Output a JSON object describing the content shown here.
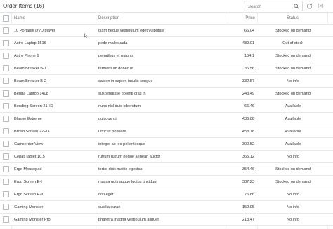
{
  "toolbar": {
    "title": "Order Items (16)",
    "search_placeholder": "Search",
    "search_icon": "magnifier-icon",
    "refresh_icon": "refresh-icon",
    "fullscreen_label": "[x]"
  },
  "table": {
    "columns": [
      "Name",
      "Description",
      "Price",
      "Status"
    ],
    "rows": [
      {
        "name": "10 Portable DVD player",
        "description": "diam neque vestibulum eget vulputate",
        "price": "66.04",
        "status": "Stocked on demand"
      },
      {
        "name": "Astro Laptop 1516",
        "description": "pede malesuada",
        "price": "489.01",
        "status": "Out of stock"
      },
      {
        "name": "Astro Phone 6",
        "description": "penatibus et magnis",
        "price": "154.1",
        "status": "Stocked on demand"
      },
      {
        "name": "Beam Breaker B-1",
        "description": "fermentum donec ut",
        "price": "36.56",
        "status": "Stocked on demand"
      },
      {
        "name": "Beam Breaker B-2",
        "description": "sapien in sapien iaculis congue",
        "price": "332.57",
        "status": "No info"
      },
      {
        "name": "Benda Laptop 1408",
        "description": "suspendisse potenti cras in",
        "price": "243.49",
        "status": "Stocked on demand"
      },
      {
        "name": "Bending Screen 21HD",
        "description": "nunc nisl duis bibendum",
        "price": "66.46",
        "status": "Available"
      },
      {
        "name": "Blaster Extreme",
        "description": "quisque ut",
        "price": "436.88",
        "status": "Available"
      },
      {
        "name": "Broad Screen 22HD",
        "description": "ultrices posuere",
        "price": "458.18",
        "status": "Available"
      },
      {
        "name": "Camcorder View",
        "description": "integer ac leo pellentesque",
        "price": "300.52",
        "status": "Available"
      },
      {
        "name": "Cepat Tablet 10.5",
        "description": "rutrum rutrum neque aenean auctor",
        "price": "365.12",
        "status": "No info"
      },
      {
        "name": "Ergo Mousepad",
        "description": "tortor duis mattis egestas",
        "price": "354.46",
        "status": "Stocked on demand"
      },
      {
        "name": "Ergo Screen E-I",
        "description": "massa quis augue luctus tincidunt",
        "price": "387.23",
        "status": "Stocked on demand"
      },
      {
        "name": "Ergo Screen E-II",
        "description": "orci eget",
        "price": "75.86",
        "status": "No info"
      },
      {
        "name": "Gaming Monster",
        "description": "cubilia curae",
        "price": "152.95",
        "status": "No info"
      },
      {
        "name": "Gaming Monster Pro",
        "description": "pharetra magna vestibulum aliquet",
        "price": "213.47",
        "status": "No info"
      }
    ]
  }
}
